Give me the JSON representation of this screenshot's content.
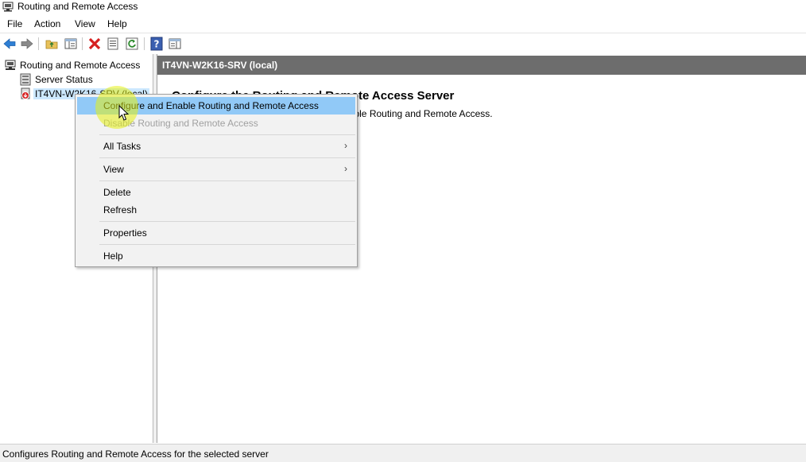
{
  "window": {
    "title": "Routing and Remote Access",
    "app_icon": "rras-server-icon"
  },
  "menubar": {
    "items": [
      "File",
      "Action",
      "View",
      "Help"
    ]
  },
  "toolbar": {
    "buttons": [
      "back-arrow-icon",
      "forward-arrow-icon",
      "up-folder-icon",
      "show-hide-tree-icon",
      "delete-icon",
      "properties-icon",
      "refresh-icon",
      "help-icon",
      "console-tree-icon"
    ]
  },
  "tree": {
    "root": "Routing and Remote Access",
    "children": [
      {
        "label": "Server Status",
        "icon": "server-status-icon"
      },
      {
        "label": "IT4VN-W2K16-SRV (local)",
        "icon": "server-down-icon",
        "selected": true
      }
    ]
  },
  "content": {
    "header": "IT4VN-W2K16-SRV (local)",
    "title": "Configure the Routing and Remote Access Server",
    "text": "n the Action menu, click Configure and Enable Routing and Remote Access."
  },
  "context_menu": {
    "items": [
      {
        "label": "Configure and Enable Routing and Remote Access",
        "state": "highlighted"
      },
      {
        "label": "Disable Routing and Remote Access",
        "state": "disabled"
      },
      {
        "label": "All Tasks",
        "submenu": true
      },
      {
        "label": "View",
        "submenu": true
      },
      {
        "label": "Delete"
      },
      {
        "label": "Refresh"
      },
      {
        "label": "Properties"
      },
      {
        "label": "Help"
      }
    ],
    "submenu_glyph": "›"
  },
  "statusbar": {
    "text": "Configures Routing and Remote Access for the selected server"
  },
  "colors": {
    "menu_highlight": "#91c9f7",
    "tree_selection": "#cce8ff",
    "pane_header": "#6d6d6d",
    "cursor_halo": "#e6f014"
  }
}
